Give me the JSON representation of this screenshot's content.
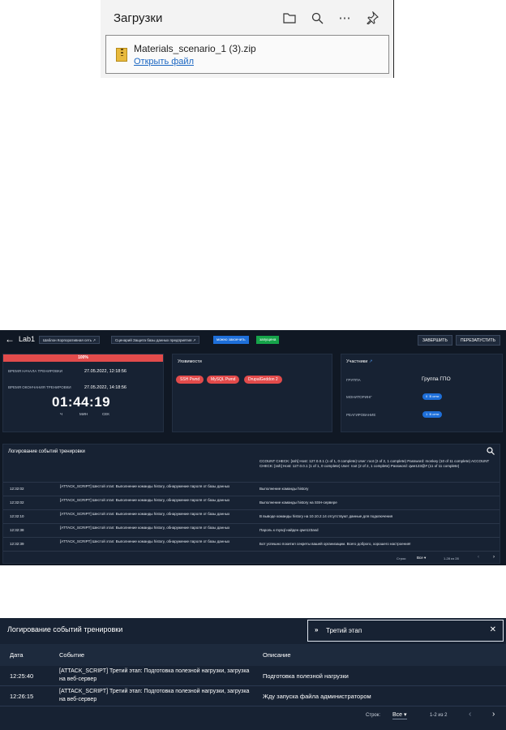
{
  "downloads": {
    "title": "Загрузки",
    "icons": [
      "folder-icon",
      "search-icon",
      "more-icon",
      "pin-icon"
    ],
    "item": {
      "filename": "Materials_scenario_1 (3).zip",
      "open_label": "Открыть файл"
    }
  },
  "dashboard": {
    "lab": "Lab1",
    "tags": [
      "Шаблон Корпоративная сеть",
      "Сценарий Защита базы данных предприятия",
      "можно закончить",
      "запущена"
    ],
    "buttons": {
      "finish": "ЗАВЕРШИТЬ",
      "restart": "ПЕРЕЗАПУСТИТЬ"
    },
    "status": {
      "progress_label": "100%",
      "progress": 1.0,
      "start_label": "ВРЕМЯ НАЧАЛА ТРЕНИРОВКИ",
      "start_value": "27.05.2022, 12:18:56",
      "end_label": "ВРЕМЯ ОКОНЧАНИЯ ТРЕНИРОВКИ",
      "end_value": "27.05.2022, 14:18:56",
      "timer": {
        "h": "01",
        "m": "44",
        "s": "19"
      },
      "units": {
        "h": "Ч",
        "m": "МИН",
        "s": "СЕК"
      }
    },
    "vulns": {
      "title": "Уязвимости",
      "items": [
        "SSH Pwnd",
        "MySQL Pwnd",
        "DrupalGeddon 2"
      ]
    },
    "participants": {
      "title": "Участники",
      "group_label": "ГРУППА",
      "group_value": "Группа ГПО",
      "monitoring_label": "МОНИТОРИНГ",
      "monitoring_count": "0",
      "monitoring_status": "В сети",
      "response_label": "РЕАГИРОВАНИЕ",
      "response_count": "1",
      "response_status": "В сети"
    },
    "log": {
      "title": "Логирование событий тренировки",
      "first_desc": "CCOUNT CHECK: [ssh] Host: 127.0.0.1 (1 of 1, 0 complete) User: root (2 of 2, 1 complete) Password: monkey (10 of 11 complete) ACCOUNT CHECK: [ssh] Host: 127.0.0.1 (1 of 1, 0 complete) User: root (2 of 2, 1 complete) Password: qwe123@# (11 of 11 complete)",
      "rows": [
        {
          "time": "12:32:02",
          "event": "[ATTACK_SCRIPT] Шестой этап: Выполнение команды history, обнаружение пароля от базы данных",
          "desc": "Выполнение команды history"
        },
        {
          "time": "12:32:02",
          "event": "[ATTACK_SCRIPT] Шестой этап: Выполнение команды history, обнаружение пароля от базы данных",
          "desc": "Выполнение команды history на SSH-сервере"
        },
        {
          "time": "12:32:10",
          "event": "[ATTACK_SCRIPT] Шестой этап: Выполнение команды history, обнаружение пароля от базы данных",
          "desc": "В выводе команды history на 10.10.2.14 отсутствуют данные для подключения"
        },
        {
          "time": "12:32:38",
          "event": "[ATTACK_SCRIPT] Шестой этап: Выполнение команды history, обнаружение пароля от базы данных",
          "desc": "Пароль к mysql найден qwe123asd"
        },
        {
          "time": "12:32:39",
          "event": "[ATTACK_SCRIPT] Шестой этап: Выполнение команды history, обнаружение пароля от базы данных",
          "desc": "Бот успешно похитил секреты вашей организации. Всего доброго, хорошего настроения!"
        }
      ],
      "rows_label": "Строк:",
      "rows_value": "Все",
      "range": "1-28 из 28"
    }
  },
  "panel": {
    "title": "Логирование событий тренировки",
    "filter": "Третий этап",
    "columns": [
      "Дата",
      "Событие",
      "Описание"
    ],
    "rows": [
      {
        "time": "12:25:40",
        "event": "[ATTACK_SCRIPT] Третий этап: Подготовка полезной нагрузки, загрузка на веб-сервер",
        "desc": "Подготовка полезной нагрузки"
      },
      {
        "time": "12:26:15",
        "event": "[ATTACK_SCRIPT] Третий этап: Подготовка полезной нагрузки, загрузка на веб-сервер",
        "desc": "Жду запуска файла администратором"
      }
    ],
    "rows_label": "Строк:",
    "rows_value": "Все",
    "range": "1-2 из 2"
  },
  "colors": {
    "accent": "#1e6fd9",
    "danger": "#e24b4b",
    "success": "#16a34a",
    "bg": "#101824"
  }
}
